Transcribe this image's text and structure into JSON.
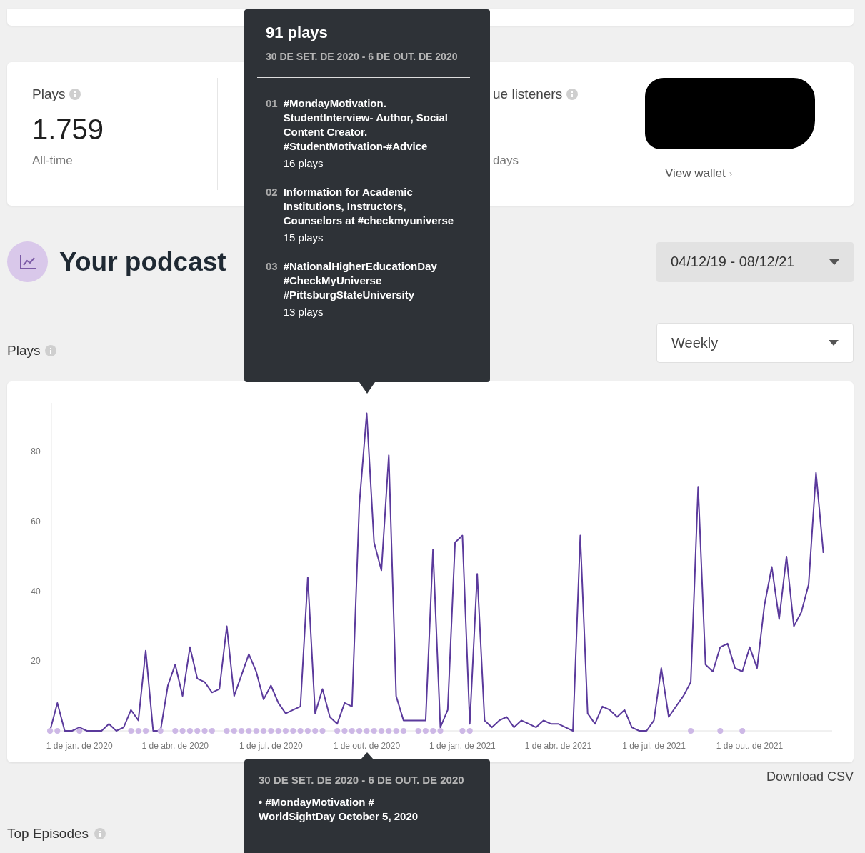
{
  "stats": [
    {
      "label": "Plays",
      "value": "1.759",
      "caption": "All-time"
    },
    {
      "label": "ue listeners",
      "caption": "days"
    }
  ],
  "wallet": {
    "link": "View wallet",
    "chevron": "›"
  },
  "performance": {
    "title": "Your podcast",
    "date_range": "04/12/19 - 08/12/21",
    "interval": "Weekly"
  },
  "chart": {
    "chart_data": {
      "type": "line",
      "ylim": [
        0,
        94
      ],
      "yticks": [
        20,
        40,
        60,
        80
      ],
      "categories": [
        null,
        null,
        null,
        null,
        "1 de jan. de 2020",
        null,
        null,
        null,
        null,
        null,
        null,
        null,
        null,
        null,
        null,
        null,
        null,
        "1 de abr. de 2020",
        null,
        null,
        null,
        null,
        null,
        null,
        null,
        null,
        null,
        null,
        null,
        null,
        "1 de jul. de 2020",
        null,
        null,
        null,
        null,
        null,
        null,
        null,
        null,
        null,
        null,
        null,
        null,
        "1 de out. de 2020",
        null,
        null,
        null,
        null,
        null,
        null,
        null,
        null,
        null,
        null,
        null,
        null,
        "1 de jan. de 2021",
        null,
        null,
        null,
        null,
        null,
        null,
        null,
        null,
        null,
        null,
        null,
        null,
        "1 de abr. de 2021",
        null,
        null,
        null,
        null,
        null,
        null,
        null,
        null,
        null,
        null,
        null,
        null,
        "1 de jul. de 2021",
        null,
        null,
        null,
        null,
        null,
        null,
        null,
        null,
        null,
        null,
        null,
        null,
        "1 de out. de 2021",
        null,
        null,
        null,
        null,
        null,
        null,
        null,
        null,
        null,
        null
      ],
      "series": [
        {
          "name": "Plays",
          "color": "#5b3a9c",
          "values": [
            0,
            8,
            0,
            0,
            1,
            0,
            0,
            0,
            2,
            0,
            1,
            6,
            3,
            23,
            0,
            0,
            13,
            19,
            10,
            24,
            15,
            14,
            11,
            12,
            30,
            10,
            16,
            22,
            17,
            9,
            13,
            8,
            5,
            6,
            7,
            44,
            5,
            12,
            4,
            2,
            8,
            7,
            65,
            91,
            54,
            46,
            79,
            10,
            3,
            3,
            3,
            3,
            52,
            1,
            6,
            54,
            56,
            2,
            45,
            3,
            1,
            3,
            4,
            1,
            3,
            2,
            1,
            3,
            2,
            2,
            1,
            0,
            56,
            5,
            2,
            7,
            6,
            4,
            6,
            1,
            0,
            0,
            3,
            18,
            4,
            7,
            10,
            14,
            70,
            19,
            17,
            24,
            25,
            18,
            17,
            24,
            18,
            36,
            47,
            32,
            50,
            30,
            34,
            42,
            74,
            51
          ]
        }
      ]
    },
    "release_weeks": [
      true,
      true,
      false,
      false,
      true,
      false,
      false,
      false,
      false,
      false,
      false,
      true,
      true,
      true,
      false,
      true,
      false,
      true,
      true,
      true,
      true,
      true,
      true,
      false,
      true,
      true,
      true,
      true,
      true,
      true,
      true,
      true,
      true,
      true,
      true,
      true,
      true,
      true,
      false,
      true,
      true,
      true,
      true,
      true,
      true,
      true,
      true,
      true,
      true,
      false,
      true,
      true,
      true,
      true,
      false,
      false,
      true,
      true,
      false,
      false,
      false,
      false,
      false,
      false,
      false,
      false,
      false,
      false,
      false,
      false,
      false,
      false,
      false,
      false,
      false,
      false,
      false,
      false,
      false,
      false,
      false,
      false,
      false,
      false,
      false,
      false,
      false,
      true,
      false,
      false,
      false,
      true,
      false,
      false,
      true,
      false,
      false,
      false,
      false,
      false,
      false,
      false,
      false,
      false,
      false,
      false
    ]
  },
  "download": "Download CSV",
  "top_episodes": "Top Episodes",
  "tooltip": {
    "total": "91 plays",
    "period": "30 DE SET. DE 2020 - 6 DE OUT. DE 2020",
    "episodes": [
      {
        "rank": "01",
        "title": "#MondayMotivation. StudentInterview- Author, Social Content Creator. #StudentMotivation-#Advice",
        "plays": "16 plays"
      },
      {
        "rank": "02",
        "title": "Information for Academic Institutions, Instructors, Counselors at #checkmyuniverse",
        "plays": "15 plays"
      },
      {
        "rank": "03",
        "title": "#NationalHigherEducationDay #CheckMyUniverse #PittsburgStateUniversity",
        "plays": "13 plays"
      }
    ]
  },
  "release_tooltip": {
    "period": "30 DE SET. DE 2020 - 6 DE OUT. DE 2020",
    "episodes": [
      "• #MondayMotivation # WorldSightDay October 5, 2020"
    ]
  }
}
